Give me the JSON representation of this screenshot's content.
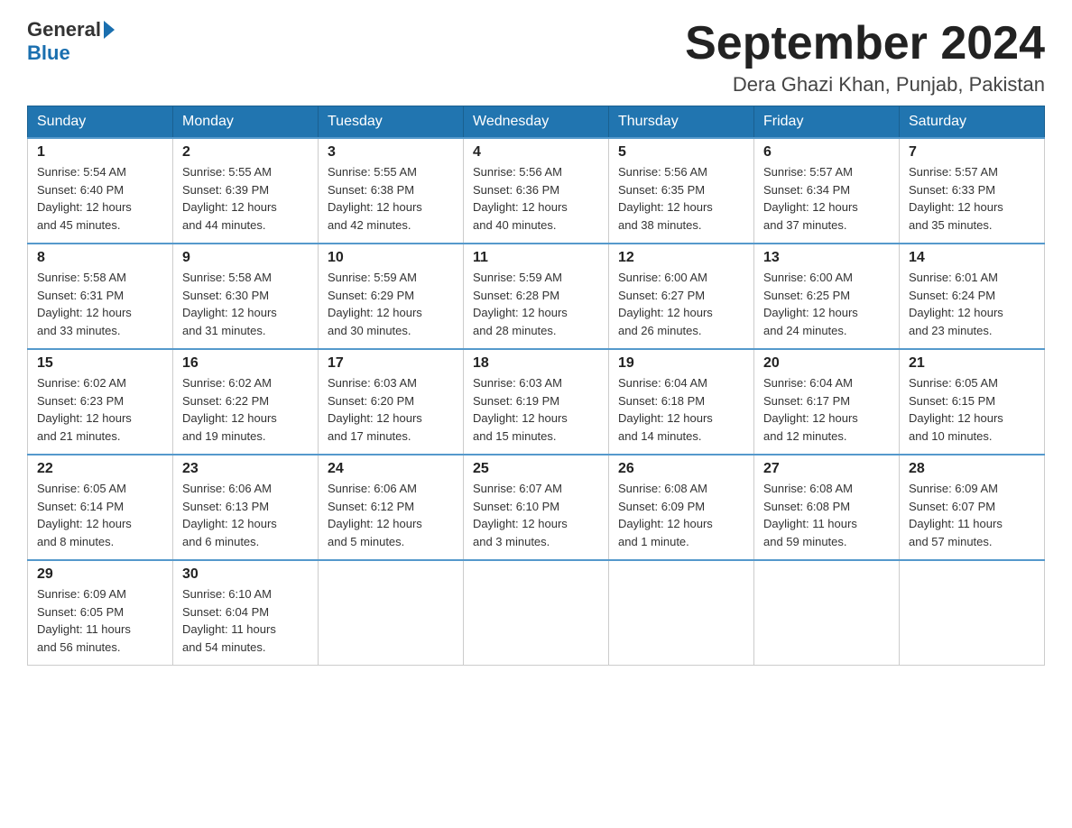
{
  "header": {
    "logo_general": "General",
    "logo_blue": "Blue",
    "title": "September 2024",
    "subtitle": "Dera Ghazi Khan, Punjab, Pakistan"
  },
  "days_of_week": [
    "Sunday",
    "Monday",
    "Tuesday",
    "Wednesday",
    "Thursday",
    "Friday",
    "Saturday"
  ],
  "weeks": [
    [
      {
        "day": "1",
        "sunrise": "5:54 AM",
        "sunset": "6:40 PM",
        "daylight": "12 hours and 45 minutes."
      },
      {
        "day": "2",
        "sunrise": "5:55 AM",
        "sunset": "6:39 PM",
        "daylight": "12 hours and 44 minutes."
      },
      {
        "day": "3",
        "sunrise": "5:55 AM",
        "sunset": "6:38 PM",
        "daylight": "12 hours and 42 minutes."
      },
      {
        "day": "4",
        "sunrise": "5:56 AM",
        "sunset": "6:36 PM",
        "daylight": "12 hours and 40 minutes."
      },
      {
        "day": "5",
        "sunrise": "5:56 AM",
        "sunset": "6:35 PM",
        "daylight": "12 hours and 38 minutes."
      },
      {
        "day": "6",
        "sunrise": "5:57 AM",
        "sunset": "6:34 PM",
        "daylight": "12 hours and 37 minutes."
      },
      {
        "day": "7",
        "sunrise": "5:57 AM",
        "sunset": "6:33 PM",
        "daylight": "12 hours and 35 minutes."
      }
    ],
    [
      {
        "day": "8",
        "sunrise": "5:58 AM",
        "sunset": "6:31 PM",
        "daylight": "12 hours and 33 minutes."
      },
      {
        "day": "9",
        "sunrise": "5:58 AM",
        "sunset": "6:30 PM",
        "daylight": "12 hours and 31 minutes."
      },
      {
        "day": "10",
        "sunrise": "5:59 AM",
        "sunset": "6:29 PM",
        "daylight": "12 hours and 30 minutes."
      },
      {
        "day": "11",
        "sunrise": "5:59 AM",
        "sunset": "6:28 PM",
        "daylight": "12 hours and 28 minutes."
      },
      {
        "day": "12",
        "sunrise": "6:00 AM",
        "sunset": "6:27 PM",
        "daylight": "12 hours and 26 minutes."
      },
      {
        "day": "13",
        "sunrise": "6:00 AM",
        "sunset": "6:25 PM",
        "daylight": "12 hours and 24 minutes."
      },
      {
        "day": "14",
        "sunrise": "6:01 AM",
        "sunset": "6:24 PM",
        "daylight": "12 hours and 23 minutes."
      }
    ],
    [
      {
        "day": "15",
        "sunrise": "6:02 AM",
        "sunset": "6:23 PM",
        "daylight": "12 hours and 21 minutes."
      },
      {
        "day": "16",
        "sunrise": "6:02 AM",
        "sunset": "6:22 PM",
        "daylight": "12 hours and 19 minutes."
      },
      {
        "day": "17",
        "sunrise": "6:03 AM",
        "sunset": "6:20 PM",
        "daylight": "12 hours and 17 minutes."
      },
      {
        "day": "18",
        "sunrise": "6:03 AM",
        "sunset": "6:19 PM",
        "daylight": "12 hours and 15 minutes."
      },
      {
        "day": "19",
        "sunrise": "6:04 AM",
        "sunset": "6:18 PM",
        "daylight": "12 hours and 14 minutes."
      },
      {
        "day": "20",
        "sunrise": "6:04 AM",
        "sunset": "6:17 PM",
        "daylight": "12 hours and 12 minutes."
      },
      {
        "day": "21",
        "sunrise": "6:05 AM",
        "sunset": "6:15 PM",
        "daylight": "12 hours and 10 minutes."
      }
    ],
    [
      {
        "day": "22",
        "sunrise": "6:05 AM",
        "sunset": "6:14 PM",
        "daylight": "12 hours and 8 minutes."
      },
      {
        "day": "23",
        "sunrise": "6:06 AM",
        "sunset": "6:13 PM",
        "daylight": "12 hours and 6 minutes."
      },
      {
        "day": "24",
        "sunrise": "6:06 AM",
        "sunset": "6:12 PM",
        "daylight": "12 hours and 5 minutes."
      },
      {
        "day": "25",
        "sunrise": "6:07 AM",
        "sunset": "6:10 PM",
        "daylight": "12 hours and 3 minutes."
      },
      {
        "day": "26",
        "sunrise": "6:08 AM",
        "sunset": "6:09 PM",
        "daylight": "12 hours and 1 minute."
      },
      {
        "day": "27",
        "sunrise": "6:08 AM",
        "sunset": "6:08 PM",
        "daylight": "11 hours and 59 minutes."
      },
      {
        "day": "28",
        "sunrise": "6:09 AM",
        "sunset": "6:07 PM",
        "daylight": "11 hours and 57 minutes."
      }
    ],
    [
      {
        "day": "29",
        "sunrise": "6:09 AM",
        "sunset": "6:05 PM",
        "daylight": "11 hours and 56 minutes."
      },
      {
        "day": "30",
        "sunrise": "6:10 AM",
        "sunset": "6:04 PM",
        "daylight": "11 hours and 54 minutes."
      },
      null,
      null,
      null,
      null,
      null
    ]
  ],
  "labels": {
    "sunrise": "Sunrise:",
    "sunset": "Sunset:",
    "daylight": "Daylight:"
  }
}
